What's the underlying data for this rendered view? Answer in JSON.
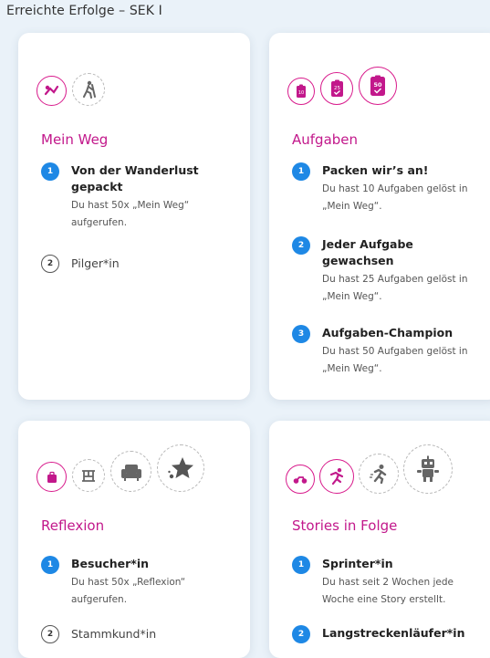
{
  "page": {
    "heading": "Erreichte Erfolge – SEK I"
  },
  "colors": {
    "accent": "#c2188b",
    "badge_done": "#1e88e5",
    "background": "#eaf2f9"
  },
  "cards": [
    {
      "title": "Mein Weg",
      "icons": [
        "route-icon",
        "hiker-icon"
      ],
      "items": [
        {
          "num": "1",
          "title": "Von der Wanderlust gepackt",
          "desc": "Du hast 50x „Mein Weg“ aufgerufen.",
          "done": true
        },
        {
          "num": "2",
          "title": "Pilger*in",
          "desc": "",
          "done": false
        }
      ]
    },
    {
      "title": "Aufgaben",
      "icons": [
        "clipboard-10-icon",
        "clipboard-25-icon",
        "clipboard-50-icon"
      ],
      "icon_labels": [
        "10",
        "25",
        "50"
      ],
      "items": [
        {
          "num": "1",
          "title": "Packen wir’s an!",
          "desc": "Du hast 10 Aufgaben gelöst in „Mein Weg“.",
          "done": true
        },
        {
          "num": "2",
          "title": "Jeder Aufgabe gewachsen",
          "desc": "Du hast 25 Aufgaben gelöst in „Mein Weg“.",
          "done": true
        },
        {
          "num": "3",
          "title": "Aufgaben-Champion",
          "desc": "Du hast 50 Aufgaben gelöst in „Mein Weg“.",
          "done": true
        }
      ]
    },
    {
      "title": "Reflexion",
      "icons": [
        "suitcase-icon",
        "hotel-bed-icon",
        "armchair-icon",
        "star-icon"
      ],
      "items": [
        {
          "num": "1",
          "title": "Besucher*in",
          "desc": "Du hast 50x „Reflexion“ aufgerufen.",
          "done": true
        },
        {
          "num": "2",
          "title": "Stammkund*in",
          "desc": "",
          "done": false
        }
      ]
    },
    {
      "title": "Stories in Folge",
      "icons": [
        "motorbike-icon",
        "sprinter-icon",
        "runner-icon",
        "robot-icon"
      ],
      "items": [
        {
          "num": "1",
          "title": "Sprinter*in",
          "desc": "Du hast seit 2 Wochen jede Woche eine Story erstellt.",
          "done": true
        },
        {
          "num": "2",
          "title": "Langstreckenläufer*in",
          "desc": "",
          "done": true
        }
      ]
    }
  ]
}
